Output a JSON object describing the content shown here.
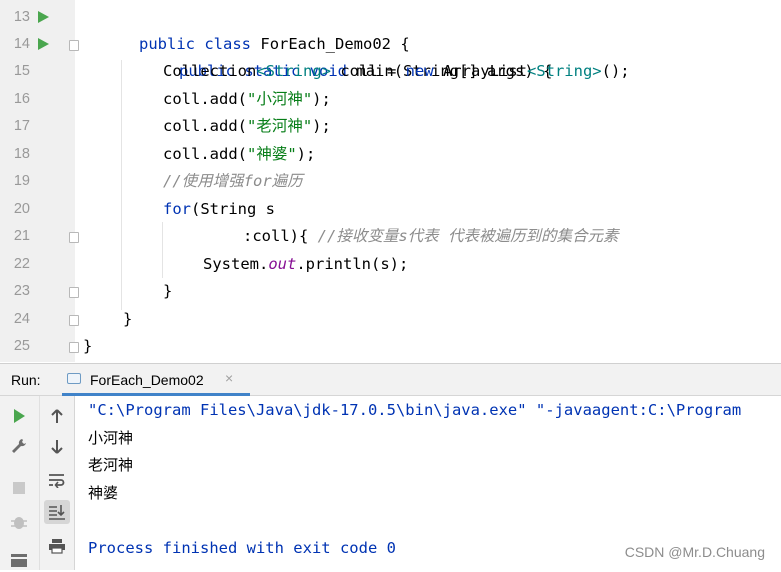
{
  "editor": {
    "line_numbers": [
      "13",
      "14",
      "15",
      "16",
      "17",
      "18",
      "19",
      "20",
      "21",
      "22",
      "23",
      "24",
      "25"
    ],
    "code": {
      "l13": {
        "kw1": "public",
        "kw2": "class",
        "name": "ForEach_Demo02",
        "brace": "{"
      },
      "l14": {
        "kw1": "public",
        "kw2": "static",
        "kw3": "void",
        "name": "main",
        "params": "(String[] args)",
        "brace": "{"
      },
      "l15": {
        "t1": "Collection",
        "g1": "<String>",
        "t2": " coll = ",
        "kw": "new",
        "t3": " ArrayList",
        "g2": "<String>",
        "t4": "();"
      },
      "l16": {
        "pre": "coll.add(",
        "str": "\"小河神\"",
        "post": ");"
      },
      "l17": {
        "pre": "coll.add(",
        "str": "\"老河神\"",
        "post": ");"
      },
      "l18": {
        "pre": "coll.add(",
        "str": "\"神婆\"",
        "post": ");"
      },
      "l19": {
        "comment": "//使用增强for遍历"
      },
      "l20": {
        "kw": "for",
        "rest": "(String s"
      },
      "l21": {
        "pre": ":coll){ ",
        "comment": "//接收变量s代表 代表被遍历到的集合元素"
      },
      "l22": {
        "pre": "System.",
        "field": "out",
        "post": ".println(s);"
      },
      "l23": {
        "brace": "}"
      },
      "l24": {
        "brace": "}"
      },
      "l25": {
        "brace": "}"
      }
    }
  },
  "run_panel": {
    "label": "Run:",
    "tab": {
      "label": "ForEach_Demo02",
      "close": "×"
    },
    "console": {
      "command": "\"C:\\Program Files\\Java\\jdk-17.0.5\\bin\\java.exe\" \"-javaagent:C:\\Program",
      "output": [
        "小河神",
        "老河神",
        "神婆"
      ],
      "finish": "Process finished with exit code 0"
    }
  },
  "toolbar_icons": [
    "run-icon",
    "wrench-icon",
    "stop-icon",
    "debug-icon",
    "layout-icon",
    "up-arrow-icon",
    "down-arrow-icon",
    "soft-wrap-icon",
    "scroll-to-end-icon",
    "print-icon"
  ],
  "watermark": "CSDN @Mr.D.Chuang",
  "colors": {
    "keyword": "#0033b3",
    "string": "#067d17",
    "comment": "#8c8c8c",
    "generic": "#008080",
    "field": "#871094",
    "run": "#4aa64e",
    "tab_underline": "#4083c9"
  }
}
